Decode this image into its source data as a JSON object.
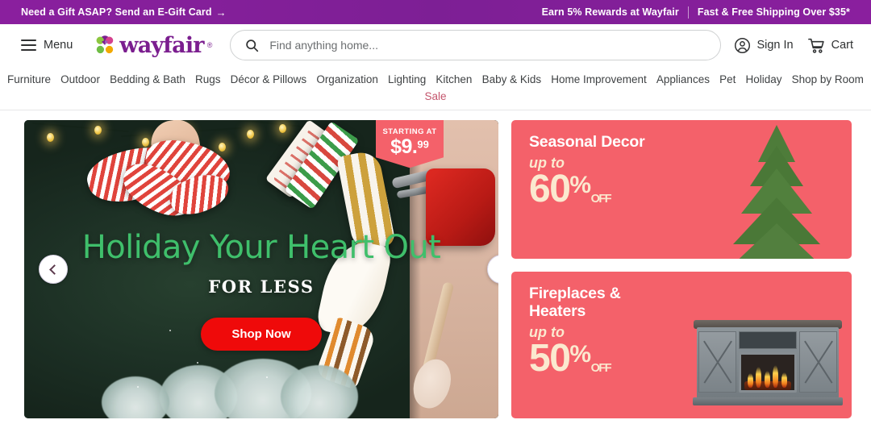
{
  "promo_bar": {
    "left_text": "Need a Gift ASAP? Send an E-Gift Card",
    "left_arrow": "→",
    "right_items": [
      "Earn 5% Rewards at Wayfair",
      "Fast & Free Shipping Over $35*"
    ],
    "background_color": "#7d1f95"
  },
  "header": {
    "menu_label": "Menu",
    "logo_text": "wayfair",
    "logo_tm": "®",
    "logo_color": "#7b1e8f",
    "search": {
      "placeholder": "Find anything home...",
      "value": "",
      "icon": "search-icon"
    },
    "sign_in_label": "Sign In",
    "sign_in_icon": "user-circle-icon",
    "cart_label": "Cart",
    "cart_icon": "shopping-cart-icon"
  },
  "nav": {
    "items": [
      "Furniture",
      "Outdoor",
      "Bedding & Bath",
      "Rugs",
      "Décor & Pillows",
      "Organization",
      "Lighting",
      "Kitchen",
      "Baby & Kids",
      "Home Improvement",
      "Appliances",
      "Pet",
      "Holiday",
      "Shop by Room"
    ],
    "sale_label": "Sale",
    "sale_color": "#c4566d"
  },
  "hero": {
    "price_flag": {
      "top_label": "STARTING AT",
      "amount": "$9.",
      "cents": "99",
      "background_color": "#f4616a"
    },
    "title": "Holiday Your Heart Out",
    "title_color": "#3fbf6b",
    "subtitle": "FOR LESS",
    "cta_label": "Shop Now",
    "cta_color": "#ef0a0a",
    "prev_icon": "chevron-left-icon",
    "next_icon": "chevron-right-icon"
  },
  "cards": [
    {
      "title": "Seasonal Decor",
      "upto": "up to",
      "percent": "60",
      "percent_symbol": "%",
      "off": "OFF",
      "background_color": "#f4616a",
      "image": "christmas-tree"
    },
    {
      "title_line1": "Fireplaces &",
      "title_line2": "Heaters",
      "upto": "up to",
      "percent": "50",
      "percent_symbol": "%",
      "off": "OFF",
      "background_color": "#f4616a",
      "image": "electric-fireplace-tv-stand"
    }
  ]
}
